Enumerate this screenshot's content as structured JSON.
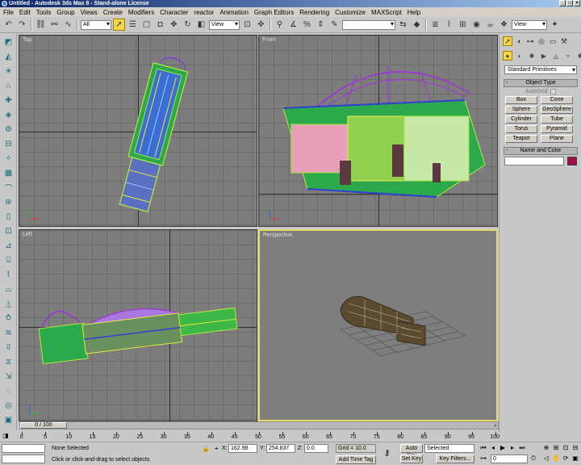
{
  "window": {
    "title": "Untitled  - Autodesk 3ds Max 8  - Stand-alone License"
  },
  "menu": [
    "File",
    "Edit",
    "Tools",
    "Group",
    "Views",
    "Create",
    "Modifiers",
    "Character",
    "reactor",
    "Animation",
    "Graph Editors",
    "Rendering",
    "Customize",
    "MAXScript",
    "Help"
  ],
  "toolbar": {
    "selection_filter": "All",
    "ref_coord": "View",
    "named_selection": "",
    "right_view_dropdown": "View"
  },
  "viewports": {
    "top": {
      "label": "Top"
    },
    "front": {
      "label": "Front"
    },
    "left": {
      "label": "Left"
    },
    "perspective": {
      "label": "Perspective"
    }
  },
  "command_panel": {
    "category": "Standard Primitives",
    "object_type_header": "Object Type",
    "autogrid_label": "AutoGrid",
    "primitives": [
      "Box",
      "Cone",
      "Sphere",
      "GeoSphere",
      "Cylinder",
      "Tube",
      "Torus",
      "Pyramid",
      "Teapot",
      "Plane"
    ],
    "name_color_header": "Name and Color",
    "object_color": "#9c0d4a"
  },
  "timeline": {
    "frame_display": "0 / 100",
    "ticks": [
      "0",
      "5",
      "10",
      "15",
      "20",
      "25",
      "30",
      "35",
      "40",
      "45",
      "50",
      "55",
      "60",
      "65",
      "70",
      "75",
      "80",
      "85",
      "90",
      "95",
      "100"
    ]
  },
  "status": {
    "selection": "None Selected",
    "prompt": "Click or click-and-drag to select objects",
    "x_label": "X:",
    "x_value": "162.98",
    "y_label": "Y:",
    "y_value": "254.837",
    "z_label": "Z:",
    "z_value": "0.0",
    "grid": "Grid = 10.0",
    "add_time_tag": "Add Time Tag",
    "auto_key": "Auto Key",
    "set_key": "Set Key",
    "key_mode": "Selected",
    "key_filters": "Key Filters...",
    "current_frame": "0"
  }
}
